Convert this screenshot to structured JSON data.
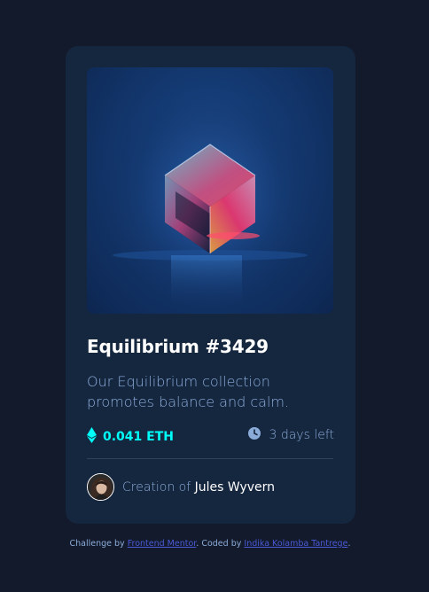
{
  "card": {
    "image_alt": "Equilibrium cube",
    "title": "Equilibrium #3429",
    "description": "Our Equilibrium collection promotes balance and calm.",
    "price": "0.041 ETH",
    "time_left": "3 days left",
    "creator_prefix": "Creation of",
    "creator_name": "Jules Wyvern"
  },
  "footer": {
    "challenge_prefix": "Challenge by",
    "challenge_link": "Frontend Mentor",
    "coded_prefix": ". Coded by",
    "coded_link": "Indika Kolamba Tantrege",
    "suffix": "."
  },
  "icons": {
    "price": "ethereum-icon",
    "time": "clock-icon",
    "avatar": "avatar-photo"
  },
  "colors": {
    "page_bg": "#131a2b",
    "card_bg": "#15263f",
    "accent_cyan": "#00fff8",
    "soft_blue": "#8bacd9",
    "white": "#ffffff",
    "link": "#4a59d6"
  }
}
